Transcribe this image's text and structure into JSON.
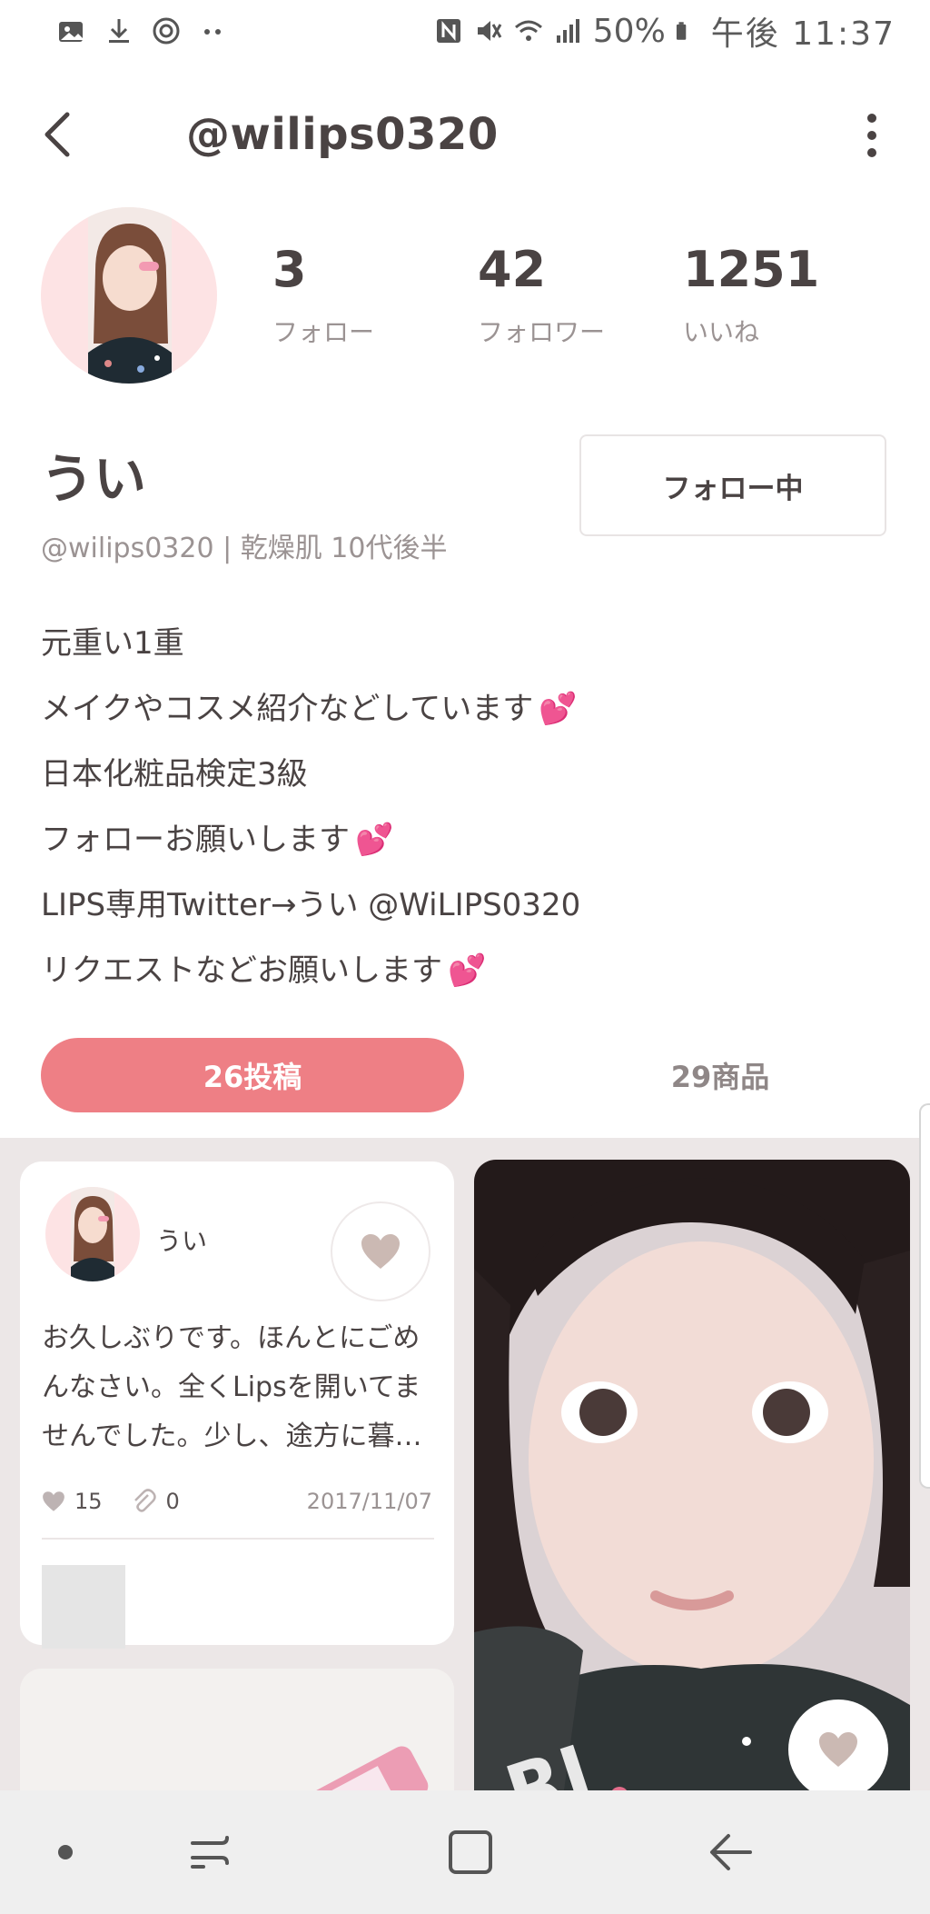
{
  "status_bar": {
    "battery": "50%",
    "time": "午後 11:37",
    "left_icons": [
      "gallery-icon",
      "download-icon",
      "target-icon",
      "more-dots-icon"
    ],
    "right_icons": [
      "nfc-icon",
      "mute-icon",
      "wifi-icon",
      "signal-icon",
      "battery-icon"
    ]
  },
  "header": {
    "title": "@wilips0320",
    "back_icon": "chevron-left-icon",
    "menu_icon": "kebab-menu-icon"
  },
  "profile": {
    "stats": [
      {
        "value": "3",
        "label": "フォロー"
      },
      {
        "value": "42",
        "label": "フォロワー"
      },
      {
        "value": "1251",
        "label": "いいね"
      }
    ],
    "name": "うい",
    "subline": "@wilips0320 | 乾燥肌 10代後半",
    "follow_button": "フォロー中",
    "bio": [
      {
        "text": "元重い1重",
        "emoji": ""
      },
      {
        "text": "メイクやコスメ紹介などしています",
        "emoji": "💕"
      },
      {
        "text": "日本化粧品検定3級",
        "emoji": ""
      },
      {
        "text": "フォローお願いします",
        "emoji": "💕"
      },
      {
        "text": "LIPS専用Twitter→うい @WiLIPS0320",
        "emoji": ""
      },
      {
        "text": "リクエストなどお願いします",
        "emoji": "💕"
      }
    ]
  },
  "tabs": {
    "posts": "26投稿",
    "products": "29商品"
  },
  "feed": {
    "card": {
      "user": "うい",
      "text": "お久しぶりです。ほんとにごめんなさい。全くLipsを開いてませんでした。少し、途方に暮…",
      "likes": "15",
      "clips": "0",
      "date": "2017/11/07"
    }
  },
  "colors": {
    "accent": "#ee7f85",
    "text": "#4a4343",
    "muted": "#9b9393",
    "feed_bg": "#ece7e7",
    "heart": "#cbb9b3"
  }
}
